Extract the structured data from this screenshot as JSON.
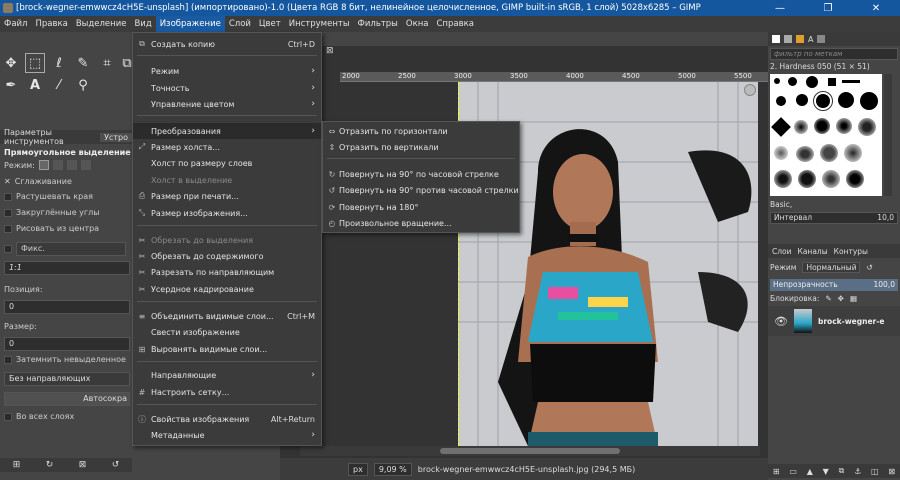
{
  "window": {
    "title": "[brock-wegner-emwwcz4cH5E-unsplash] (импортировано)-1.0 (Цвета RGB 8 бит, нелинейное целочисленное, GIMP built-in sRGB, 1 слой) 5028x6285 – GIMP",
    "minimize": "—",
    "maximize": "❐",
    "close": "✕"
  },
  "menubar": [
    "Файл",
    "Правка",
    "Выделение",
    "Вид",
    "Изображение",
    "Слой",
    "Цвет",
    "Инструменты",
    "Фильтры",
    "Окна",
    "Справка"
  ],
  "tool_options": {
    "tabs": [
      "Параметры инструментов",
      "Устро"
    ],
    "title": "Прямоугольное выделение",
    "mode_label": "Режим:",
    "antialias": "Сглаживание",
    "feather": "Растушевать края",
    "rounded": "Закруглённые углы",
    "from_center": "Рисовать из центра",
    "fixed": "Фикс.",
    "ratio": "1:1",
    "position_label": "Позиция:",
    "position_value": "0",
    "size_label": "Размер:",
    "size_value": "0",
    "shade": "Затемнить невыделенное",
    "guides": "Без направляющих",
    "autoshrink": "Автосокра",
    "all_layers": "Во всех слоях"
  },
  "image_menu": {
    "items": [
      {
        "label": "Создать копию",
        "shortcut": "Ctrl+D",
        "icon": "⧉"
      },
      {
        "label": "Режим",
        "submenu": true
      },
      {
        "label": "Точность",
        "submenu": true
      },
      {
        "label": "Управление цветом",
        "submenu": true
      },
      {
        "label": "Преобразования",
        "submenu": true,
        "highlighted": true
      },
      {
        "label": "Размер холста...",
        "icon": "⤢"
      },
      {
        "label": "Холст по размеру слоев"
      },
      {
        "label": "Холст в выделение",
        "disabled": true
      },
      {
        "label": "Размер при печати...",
        "icon": "⎙"
      },
      {
        "label": "Размер изображения...",
        "icon": "⤡"
      },
      {
        "label": "Обрезать до выделения",
        "disabled": true,
        "icon": "✂"
      },
      {
        "label": "Обрезать до содержимого",
        "icon": "✂"
      },
      {
        "label": "Разрезать по направляющим",
        "icon": "✂"
      },
      {
        "label": "Усердное кадрирование",
        "icon": "✂"
      },
      {
        "label": "Объединить видимые слои...",
        "shortcut": "Ctrl+M",
        "icon": "≡"
      },
      {
        "label": "Свести изображение"
      },
      {
        "label": "Выровнять видимые слои...",
        "icon": "⊞"
      },
      {
        "label": "Направляющие",
        "submenu": true
      },
      {
        "label": "Настроить сетку...",
        "icon": "#"
      },
      {
        "label": "Свойства изображения",
        "shortcut": "Alt+Return",
        "icon": "ⓘ"
      },
      {
        "label": "Метаданные",
        "submenu": true
      }
    ]
  },
  "transform_submenu": {
    "items": [
      {
        "label": "Отразить по горизонтали",
        "icon": "⇔"
      },
      {
        "label": "Отразить по вертикали",
        "icon": "⇕"
      },
      {
        "label": "Повернуть на 90° по часовой стрелке",
        "icon": "↻"
      },
      {
        "label": "Повернуть на 90° против часовой стрелки",
        "icon": "↺"
      },
      {
        "label": "Повернуть на 180°",
        "icon": "⟳"
      },
      {
        "label": "Произвольное вращение...",
        "icon": "◴"
      }
    ]
  },
  "ruler_labels": [
    "2000",
    "2500",
    "3000",
    "3500",
    "4000",
    "4500",
    "5000",
    "5500"
  ],
  "status": {
    "unit": "px",
    "zoom": "9,09 %",
    "file": "brock-wegner-emwwcz4cH5E-unsplash.jpg (294,5 МБ)"
  },
  "brushes": {
    "filter_placeholder": "фильтр по меткам",
    "current": "2. Hardness 050 (51 × 51)",
    "preset": "Basic,",
    "spacing_label": "Интервал",
    "spacing_value": "10,0"
  },
  "layers": {
    "tabs": [
      "Слои",
      "Каналы",
      "Контуры"
    ],
    "mode_label": "Режим",
    "mode_value": "Нормальный",
    "opacity_label": "Непрозрачность",
    "opacity_value": "100,0",
    "lock_label": "Блокировка:",
    "layer_name": "brock-wegner-e"
  },
  "colors": {
    "menu_bg": "#3b3b3b",
    "highlight": "#1a5aa0",
    "titlebar": "#15579e"
  }
}
